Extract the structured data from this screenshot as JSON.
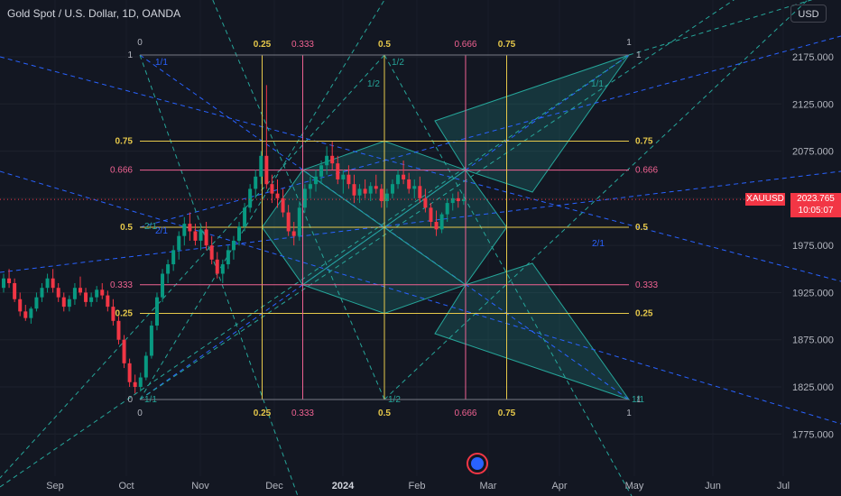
{
  "header": {
    "title": "Gold Spot / U.S. Dollar, 1D, OANDA",
    "currency_button": "USD"
  },
  "price_tag": {
    "symbol": "XAUUSD",
    "price": "2023.765",
    "countdown": "10:05:07"
  },
  "colors": {
    "background": "#131722",
    "up": "#089981",
    "down": "#f23645",
    "quarter": "#e6c84a",
    "third": "#f06292",
    "teal": "#26a69a",
    "blue": "#2962ff"
  },
  "chart_data": {
    "type": "candlestick",
    "title": "Gold Spot / U.S. Dollar, 1D, OANDA",
    "x_ticks": [
      "Sep",
      "Oct",
      "Nov",
      "Dec",
      "2024",
      "Feb",
      "Mar",
      "Apr",
      "May",
      "Jun",
      "Jul"
    ],
    "y_ticks": [
      "2175.000",
      "2125.000",
      "2075.000",
      "2025.000",
      "1975.000",
      "1925.000",
      "1875.000",
      "1825.000",
      "1775.000"
    ],
    "ylim": [
      1755,
      2225
    ],
    "last_price": 2023.765,
    "candles": [
      [
        1930,
        1945,
        1925,
        1940
      ],
      [
        1940,
        1950,
        1930,
        1935
      ],
      [
        1935,
        1940,
        1915,
        1918
      ],
      [
        1918,
        1925,
        1900,
        1905
      ],
      [
        1905,
        1912,
        1895,
        1898
      ],
      [
        1898,
        1910,
        1892,
        1908
      ],
      [
        1908,
        1925,
        1905,
        1920
      ],
      [
        1920,
        1935,
        1915,
        1930
      ],
      [
        1930,
        1945,
        1925,
        1940
      ],
      [
        1940,
        1950,
        1925,
        1930
      ],
      [
        1930,
        1935,
        1915,
        1920
      ],
      [
        1920,
        1925,
        1905,
        1910
      ],
      [
        1910,
        1922,
        1905,
        1918
      ],
      [
        1918,
        1935,
        1912,
        1930
      ],
      [
        1930,
        1942,
        1922,
        1925
      ],
      [
        1925,
        1930,
        1910,
        1915
      ],
      [
        1915,
        1925,
        1910,
        1920
      ],
      [
        1920,
        1932,
        1915,
        1928
      ],
      [
        1928,
        1935,
        1918,
        1922
      ],
      [
        1922,
        1927,
        1905,
        1910
      ],
      [
        1910,
        1918,
        1890,
        1895
      ],
      [
        1895,
        1900,
        1870,
        1875
      ],
      [
        1875,
        1880,
        1845,
        1850
      ],
      [
        1850,
        1855,
        1825,
        1830
      ],
      [
        1830,
        1838,
        1818,
        1825
      ],
      [
        1825,
        1840,
        1820,
        1835
      ],
      [
        1835,
        1862,
        1832,
        1858
      ],
      [
        1858,
        1895,
        1855,
        1890
      ],
      [
        1890,
        1925,
        1885,
        1920
      ],
      [
        1920,
        1950,
        1915,
        1945
      ],
      [
        1945,
        1960,
        1935,
        1955
      ],
      [
        1955,
        1975,
        1948,
        1970
      ],
      [
        1970,
        1990,
        1960,
        1985
      ],
      [
        1985,
        2005,
        1975,
        1998
      ],
      [
        1998,
        2010,
        1980,
        1990
      ],
      [
        1990,
        1998,
        1975,
        1980
      ],
      [
        1980,
        1995,
        1970,
        1992
      ],
      [
        1992,
        2000,
        1970,
        1975
      ],
      [
        1975,
        1985,
        1955,
        1960
      ],
      [
        1960,
        1968,
        1940,
        1945
      ],
      [
        1945,
        1960,
        1935,
        1955
      ],
      [
        1955,
        1975,
        1950,
        1970
      ],
      [
        1970,
        1985,
        1960,
        1980
      ],
      [
        1980,
        2000,
        1975,
        1995
      ],
      [
        1995,
        2020,
        1990,
        2015
      ],
      [
        2015,
        2040,
        2010,
        2035
      ],
      [
        2035,
        2055,
        2025,
        2048
      ],
      [
        2048,
        2075,
        2040,
        2070
      ],
      [
        2070,
        2145,
        2035,
        2040
      ],
      [
        2040,
        2050,
        2020,
        2030
      ],
      [
        2030,
        2045,
        2015,
        2025
      ],
      [
        2025,
        2035,
        2005,
        2010
      ],
      [
        2010,
        2018,
        1985,
        1990
      ],
      [
        1990,
        2000,
        1975,
        1985
      ],
      [
        1985,
        2020,
        1980,
        2015
      ],
      [
        2015,
        2040,
        2010,
        2035
      ],
      [
        2035,
        2048,
        2025,
        2040
      ],
      [
        2040,
        2055,
        2032,
        2048
      ],
      [
        2048,
        2065,
        2040,
        2060
      ],
      [
        2060,
        2080,
        2050,
        2070
      ],
      [
        2070,
        2085,
        2055,
        2062
      ],
      [
        2062,
        2070,
        2040,
        2045
      ],
      [
        2045,
        2055,
        2030,
        2050
      ],
      [
        2050,
        2060,
        2035,
        2040
      ],
      [
        2040,
        2050,
        2020,
        2028
      ],
      [
        2028,
        2040,
        2020,
        2035
      ],
      [
        2035,
        2045,
        2025,
        2030
      ],
      [
        2030,
        2042,
        2022,
        2038
      ],
      [
        2038,
        2050,
        2030,
        2035
      ],
      [
        2035,
        2040,
        2015,
        2022
      ],
      [
        2022,
        2035,
        2015,
        2030
      ],
      [
        2030,
        2045,
        2025,
        2040
      ],
      [
        2040,
        2055,
        2035,
        2050
      ],
      [
        2050,
        2065,
        2040,
        2045
      ],
      [
        2045,
        2052,
        2030,
        2035
      ],
      [
        2035,
        2045,
        2025,
        2038
      ],
      [
        2038,
        2048,
        2020,
        2025
      ],
      [
        2025,
        2035,
        2010,
        2015
      ],
      [
        2015,
        2020,
        1995,
        2000
      ],
      [
        2000,
        2012,
        1985,
        1992
      ],
      [
        1992,
        2010,
        1988,
        2008
      ],
      [
        2008,
        2025,
        2000,
        2020
      ],
      [
        2020,
        2030,
        2012,
        2025
      ],
      [
        2025,
        2032,
        2015,
        2022
      ],
      [
        2022,
        2030,
        2018,
        2024
      ]
    ],
    "overlays": [
      {
        "name": "gann-box",
        "x_levels": [
          "0",
          "0.25",
          "0.333",
          "0.5",
          "0.666",
          "0.75",
          "1"
        ],
        "y_levels": [
          "0",
          "0.25",
          "0.333",
          "0.5",
          "0.666",
          "0.75",
          "1"
        ],
        "fan_labels": [
          "1/1",
          "1/2",
          "2/1"
        ]
      }
    ]
  }
}
